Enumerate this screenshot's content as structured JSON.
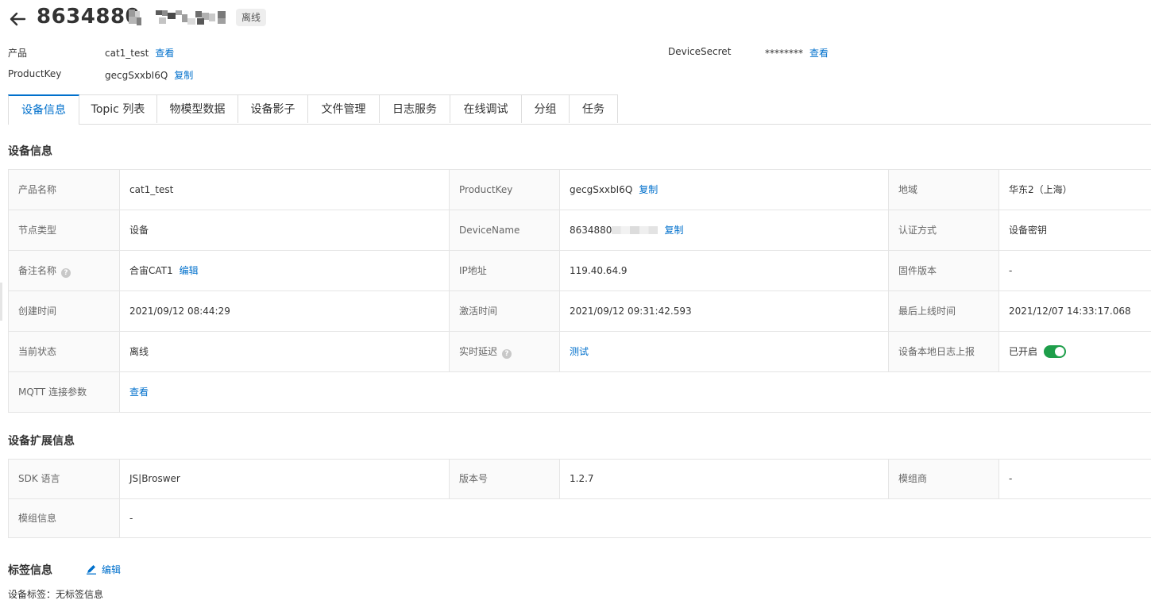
{
  "header": {
    "title_visible": "8634880",
    "status": "离线"
  },
  "meta": {
    "product_label": "产品",
    "product_value": "cat1_test",
    "product_link": "查看",
    "productkey_label": "ProductKey",
    "productkey_value": "gecgSxxbI6Q",
    "productkey_link": "复制",
    "devicesecret_label": "DeviceSecret",
    "devicesecret_value": "********",
    "devicesecret_link": "查看"
  },
  "tabs": [
    {
      "label": "设备信息"
    },
    {
      "label": "Topic 列表"
    },
    {
      "label": "物模型数据"
    },
    {
      "label": "设备影子"
    },
    {
      "label": "文件管理"
    },
    {
      "label": "日志服务"
    },
    {
      "label": "在线调试"
    },
    {
      "label": "分组"
    },
    {
      "label": "任务"
    }
  ],
  "device_info": {
    "title": "设备信息",
    "copy_label": "复制",
    "edit_label": "编辑",
    "rows": [
      [
        "产品名称",
        "cat1_test",
        "ProductKey",
        "gecgSxxbI6Q",
        "地域",
        "华东2（上海）"
      ],
      [
        "节点类型",
        "设备",
        "DeviceName",
        "8634880",
        "认证方式",
        "设备密钥"
      ],
      [
        "备注名称",
        "合宙CAT1",
        "IP地址",
        "119.40.64.9",
        "固件版本",
        "-"
      ],
      [
        "创建时间",
        "2021/09/12 08:44:29",
        "激活时间",
        "2021/09/12 09:31:42.593",
        "最后上线时间",
        "2021/12/07 14:33:17.068"
      ],
      [
        "当前状态",
        "离线",
        "实时延迟",
        "测试",
        "设备本地日志上报",
        "已开启"
      ]
    ],
    "mqtt_label": "MQTT 连接参数",
    "mqtt_link": "查看"
  },
  "extended_info": {
    "title": "设备扩展信息",
    "rows": [
      [
        "SDK 语言",
        "JS|Broswer",
        "版本号",
        "1.2.7",
        "模组商",
        "-"
      ]
    ],
    "module_label": "模组信息",
    "module_value": "-"
  },
  "tags": {
    "title": "标签信息",
    "edit_label": "编辑",
    "device_tags_label": "设备标签：",
    "device_tags_value": "无标签信息"
  },
  "colors": {
    "accent": "#0070cc",
    "toggle_on": "#1e9e4a",
    "border": "#e5e5e5",
    "label_bg": "#fafafa"
  },
  "icons": {
    "back": "arrow-left-icon",
    "help": "question-circle-icon",
    "edit": "pencil-icon",
    "toggle": "switch-on"
  },
  "log_report_enabled": true
}
